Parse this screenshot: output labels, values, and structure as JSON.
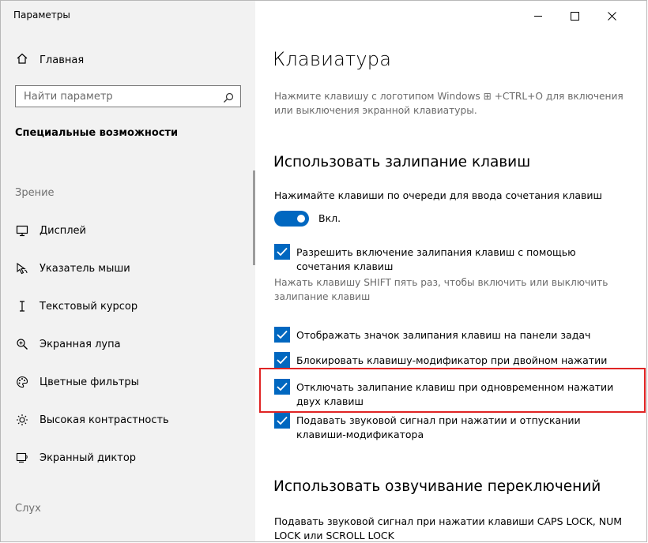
{
  "window": {
    "title": "Параметры",
    "controls": [
      "minimize-icon",
      "maximize-icon",
      "close-icon"
    ]
  },
  "sidebar": {
    "home_label": "Главная",
    "search_placeholder": "Найти параметр",
    "section_title": "Специальные возможности",
    "group_vision": "Зрение",
    "items": [
      {
        "label": "Дисплей",
        "icon": "display-icon"
      },
      {
        "label": "Указатель мыши",
        "icon": "mouse-pointer-icon"
      },
      {
        "label": "Текстовый курсор",
        "icon": "text-cursor-icon"
      },
      {
        "label": "Экранная лупа",
        "icon": "magnifier-icon"
      },
      {
        "label": "Цветные фильтры",
        "icon": "color-filter-icon"
      },
      {
        "label": "Высокая контрастность",
        "icon": "high-contrast-icon"
      },
      {
        "label": "Экранный диктор",
        "icon": "narrator-icon"
      }
    ],
    "group_hearing": "Слух"
  },
  "main": {
    "title": "Клавиатура",
    "description": "Нажмите клавишу с логотипом Windows ⊞ +CTRL+O для включения или выключения экранной клавиатуры.",
    "sticky_heading": "Использовать залипание клавиш",
    "sticky_prompt": "Нажимайте клавиши по очереди для ввода сочетания клавиш",
    "toggle_state": "Вкл.",
    "accent_color": "#0067c0",
    "options": [
      {
        "label": "Разрешить включение залипания клавиш с помощью сочетания клавиш",
        "checked": true
      },
      {
        "label": "Отображать значок залипания клавиш на панели задач",
        "checked": true
      },
      {
        "label": "Блокировать клавишу-модификатор при двойном нажатии",
        "checked": true
      },
      {
        "label": "Отключать залипание клавиш при одновременном нажатии двух клавиш",
        "checked": true
      },
      {
        "label": "Подавать звуковой сигнал при нажатии и отпускании клавиши-модификатора",
        "checked": true
      }
    ],
    "option1_hint": "Нажать клавишу SHIFT пять раз, чтобы включить или выключить залипание клавиш",
    "toggle_heading": "Использовать озвучивание переключений",
    "toggle_desc": "Подавать звуковой сигнал при нажатии клавиши CAPS LOCK, NUM LOCK или SCROLL LOCK",
    "highlight_color": "#e02424"
  }
}
